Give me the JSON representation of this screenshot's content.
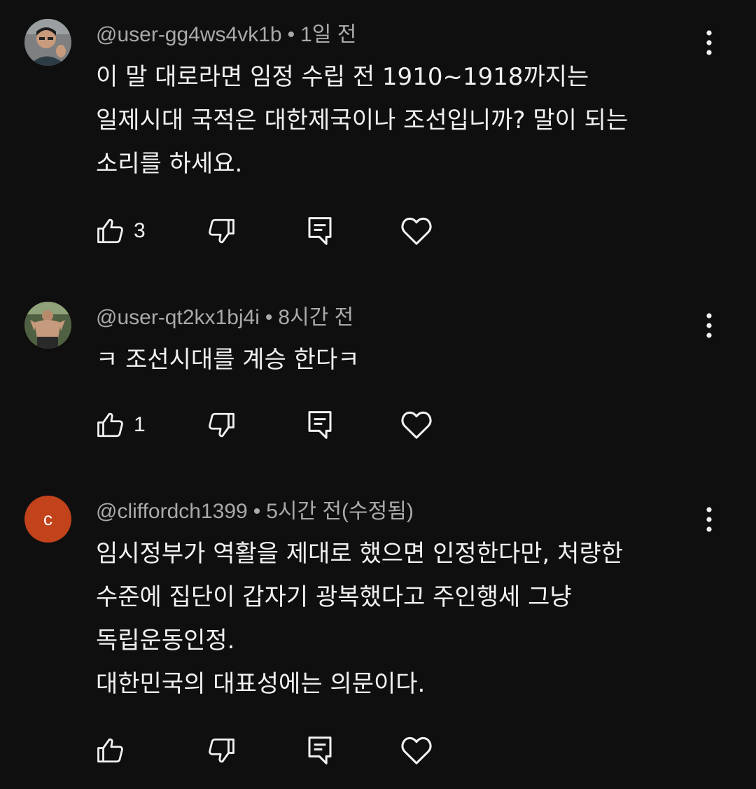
{
  "comments": [
    {
      "author": "@user-gg4ws4vk1b",
      "separator": "•",
      "time": "1일 전",
      "avatar": {
        "type": "photo",
        "bg": "#6a6a6a"
      },
      "lines": [
        "이 말 대로라면 임정 수립 전 1910~1918까지는",
        "일제시대 국적은 대한제국이나 조선입니까? 말이 되는",
        "소리를 하세요."
      ],
      "likes": "3",
      "icons": [
        "thumbs-up-icon",
        "thumbs-down-icon",
        "reply-icon",
        "heart-icon",
        "more-vertical-icon"
      ]
    },
    {
      "author": "@user-qt2kx1bj4i",
      "separator": "•",
      "time": "8시간 전",
      "avatar": {
        "type": "photo",
        "bg": "#5d6b4c"
      },
      "lines": [
        "ㅋ 조선시대를 계승 한다ㅋ"
      ],
      "likes": "1",
      "icons": [
        "thumbs-up-icon",
        "thumbs-down-icon",
        "reply-icon",
        "heart-icon",
        "more-vertical-icon"
      ]
    },
    {
      "author": "@cliffordch1399",
      "separator": "•",
      "time": "5시간 전(수정됨)",
      "avatar": {
        "type": "letter",
        "letter": "c",
        "bg": "#c1421b"
      },
      "lines": [
        "임시정부가 역활을 제대로 했으면 인정한다만,  처량한",
        "수준에 집단이 갑자기 광복했다고 주인행세 그냥",
        "독립운동인정.",
        "대한민국의 대표성에는 의문이다."
      ],
      "likes": "",
      "icons": [
        "thumbs-up-icon",
        "thumbs-down-icon",
        "reply-icon",
        "heart-icon",
        "more-vertical-icon"
      ]
    }
  ],
  "colors": {
    "background": "#0f0f0f",
    "text": "#f1f1f1",
    "meta": "#aaaaaa"
  }
}
